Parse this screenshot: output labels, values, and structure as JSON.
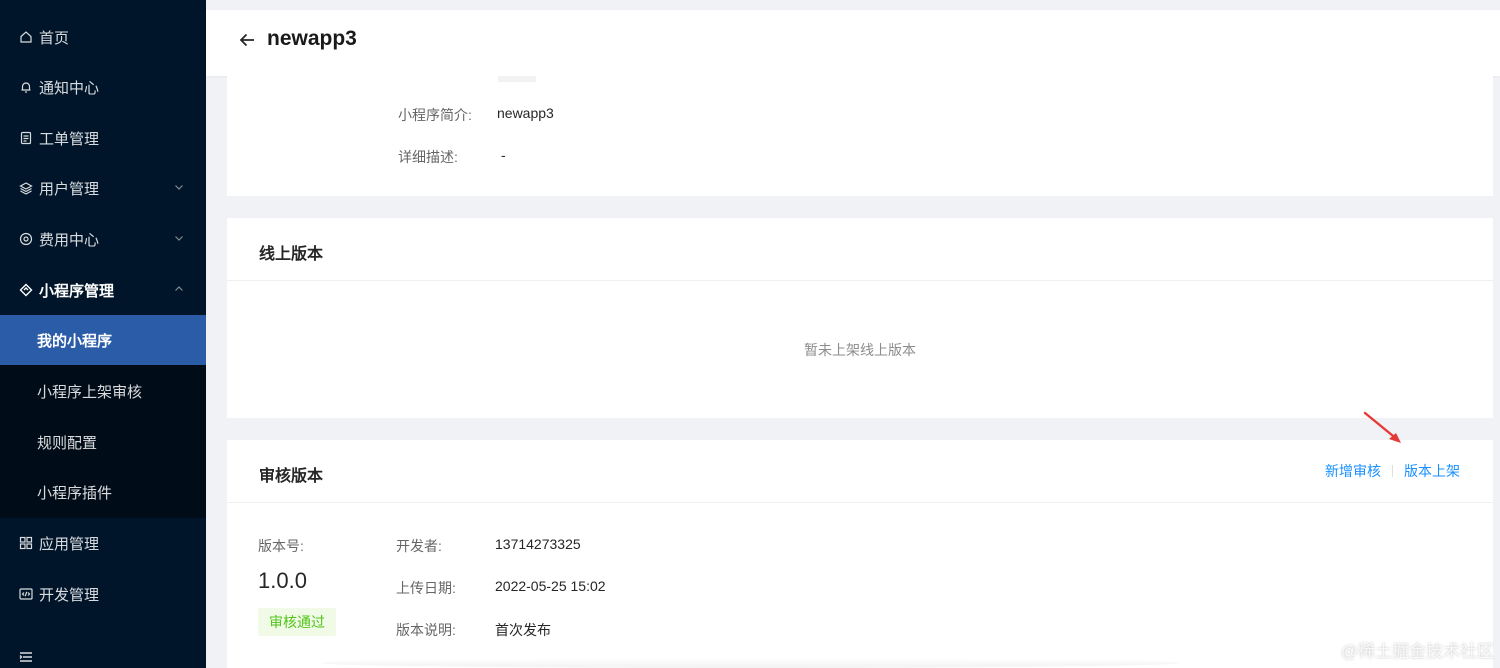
{
  "sidebar": {
    "items": [
      {
        "label": "首页",
        "icon": "home-icon"
      },
      {
        "label": "通知中心",
        "icon": "bell-icon"
      },
      {
        "label": "工单管理",
        "icon": "clipboard-icon"
      },
      {
        "label": "用户管理",
        "icon": "layers-icon"
      },
      {
        "label": "费用中心",
        "icon": "coin-icon"
      },
      {
        "label": "小程序管理",
        "icon": "diamond-icon"
      },
      {
        "label": "应用管理",
        "icon": "grid-icon"
      },
      {
        "label": "开发管理",
        "icon": "code-icon"
      }
    ],
    "submenu": [
      {
        "label": "我的小程序"
      },
      {
        "label": "小程序上架审核"
      },
      {
        "label": "规则配置"
      },
      {
        "label": "小程序插件"
      }
    ],
    "active_item": "我的小程序"
  },
  "header": {
    "title": "newapp3"
  },
  "info": {
    "intro_label": "小程序简介:",
    "intro_value": "newapp3",
    "desc_label": "详细描述:",
    "desc_value": "-"
  },
  "online": {
    "title": "线上版本",
    "empty_text": "暂未上架线上版本"
  },
  "review": {
    "title": "审核版本",
    "add_review_label": "新增审核",
    "publish_label": "版本上架",
    "version_label": "版本号:",
    "version_value": "1.0.0",
    "status": "审核通过",
    "developer_label": "开发者:",
    "developer_value": "13714273325",
    "upload_label": "上传日期:",
    "upload_value": "2022-05-25 15:02",
    "notes_label": "版本说明:",
    "notes_value": "首次发布"
  },
  "watermark": "@稀土掘金技术社区",
  "colors": {
    "sidebar_bg": "#001529",
    "submenu_bg": "#000c17",
    "active_bg": "#2a5ca8",
    "link": "#1890ff",
    "success": "#52c41a",
    "annotation_arrow": "#e53935"
  }
}
